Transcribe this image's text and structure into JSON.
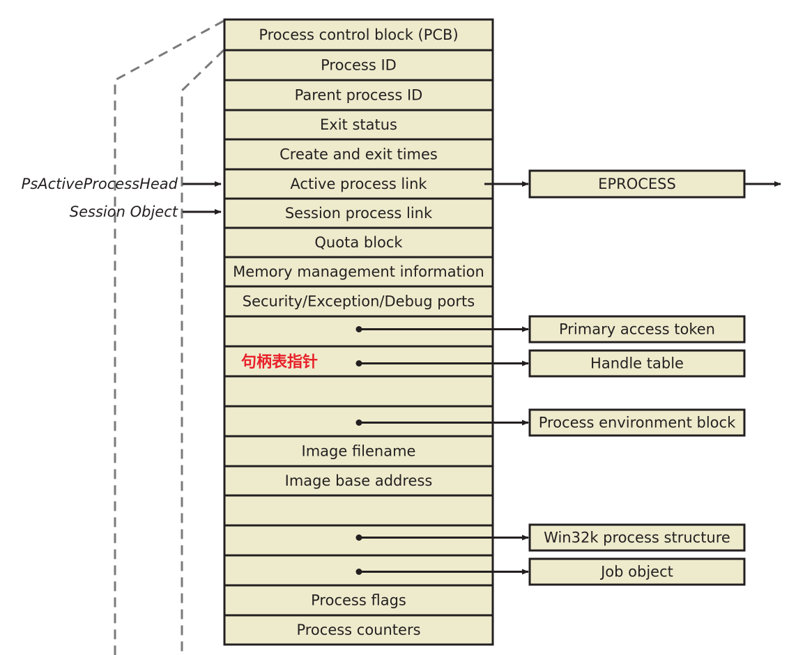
{
  "diagram": {
    "colors": {
      "fill": "#eeebcd",
      "stroke": "#231f20",
      "dash": "#7a7a7a",
      "annotation": "#e8202a"
    },
    "rows": [
      {
        "label": "Process control block (PCB)"
      },
      {
        "label": "Process ID"
      },
      {
        "label": "Parent process ID"
      },
      {
        "label": "Exit status"
      },
      {
        "label": "Create and exit times"
      },
      {
        "label": "Active process link",
        "target": "EPROCESS"
      },
      {
        "label": "Session process link"
      },
      {
        "label": "Quota block"
      },
      {
        "label": "Memory management information"
      },
      {
        "label": "Security/Exception/Debug ports"
      },
      {
        "label": "",
        "target": "Primary access token"
      },
      {
        "label": "",
        "annotation": "句柄表指针",
        "target": "Handle table"
      },
      {
        "label": ""
      },
      {
        "label": "",
        "target": "Process environment block"
      },
      {
        "label": "Image filename"
      },
      {
        "label": "Image base address"
      },
      {
        "label": ""
      },
      {
        "label": "",
        "target": "Win32k process structure"
      },
      {
        "label": "",
        "target": "Job object"
      },
      {
        "label": "Process flags"
      },
      {
        "label": "Process counters"
      }
    ],
    "external_inputs": [
      {
        "label": "PsActiveProcessHead",
        "row": 5
      },
      {
        "label": "Session Object",
        "row": 6
      }
    ]
  }
}
